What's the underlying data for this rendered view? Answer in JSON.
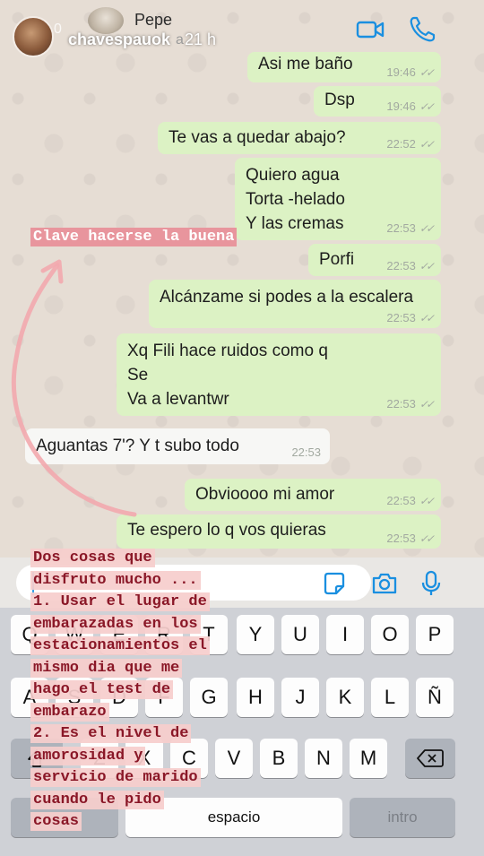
{
  "story": {
    "username": "chavespauok",
    "time": "21 h",
    "ghost_zero": "0",
    "ghost_a": "a"
  },
  "chat": {
    "contact_name": "Pepe",
    "messages": [
      {
        "text": "Asi me baño",
        "time": "19:46",
        "dir": "out"
      },
      {
        "text": "Dsp",
        "time": "19:46",
        "dir": "out"
      },
      {
        "text": "Te vas a quedar abajo?",
        "time": "22:52",
        "dir": "out"
      },
      {
        "text": "Quiero agua\nTorta -helado\nY las cremas",
        "time": "22:53",
        "dir": "out"
      },
      {
        "text": "Porfi",
        "time": "22:53",
        "dir": "out"
      },
      {
        "text": "Alcánzame si podes a la escalera",
        "time": "22:53",
        "dir": "out"
      },
      {
        "text": "Xq Fili hace ruidos como q\nSe\nVa a levantwr",
        "time": "22:53",
        "dir": "out"
      },
      {
        "text": "Aguantas 7'? Y t subo todo",
        "time": "22:53",
        "dir": "in"
      },
      {
        "text": "Obvioooo mi amor",
        "time": "22:53",
        "dir": "out"
      },
      {
        "text": "Te espero lo q vos quieras",
        "time": "22:53",
        "dir": "out"
      }
    ]
  },
  "annotation": {
    "label": "Clave hacerse la buena",
    "color": "#e8959d"
  },
  "story_note": {
    "lines": [
      "Dos cosas que",
      "disfruto mucho ...",
      "1. Usar el lugar de",
      "embarazadas en los",
      "estacionamientos el",
      "mismo dia que me",
      "hago el test de",
      "embarazo",
      "2. Es el nivel de",
      "amorosidad y",
      "servicio de marido",
      "cuando le pido",
      "cosas"
    ]
  },
  "keyboard": {
    "row1": [
      "Q",
      "W",
      "E",
      "R",
      "T",
      "Y",
      "U",
      "I",
      "O",
      "P"
    ],
    "row2": [
      "A",
      "S",
      "D",
      "F",
      "G",
      "H",
      "J",
      "K",
      "L",
      "Ñ"
    ],
    "row3": [
      "Z",
      "X",
      "C",
      "V",
      "B",
      "N",
      "M"
    ],
    "space_label": "espacio",
    "return_label": "intro"
  },
  "icons": {
    "header": [
      "video-call-icon",
      "phone-call-icon"
    ],
    "input": [
      "sticker-icon",
      "camera-icon",
      "microphone-icon"
    ],
    "keyboard": [
      "backspace-icon"
    ]
  },
  "colors": {
    "outgoing_bubble": "#dcf2c4",
    "incoming_bubble": "#f7f7f5",
    "accent": "#1a8fe0",
    "note_bg": "#f6cecc",
    "note_text": "#8a1727"
  }
}
